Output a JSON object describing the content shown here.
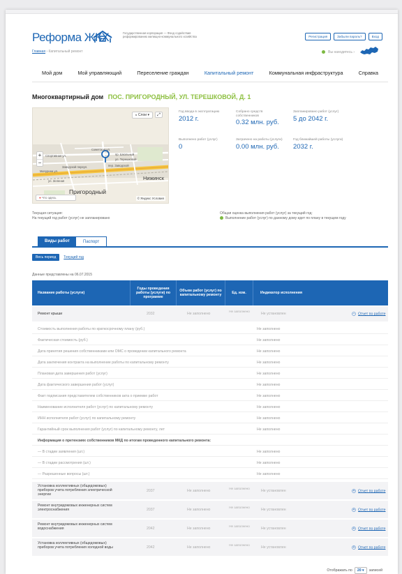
{
  "header": {
    "logo_text": "Реформа ЖКХ",
    "org_text": "Государственная корпорация — Фонд содействия реформированию жилищно-коммунального хозяйства",
    "breadcrumb_home": "Главная",
    "breadcrumb_sep": "›",
    "breadcrumb_current": "Капитальный ремонт",
    "buttons": {
      "register": "Регистрация",
      "forgot": "Забыли пароль?",
      "login": "Вход"
    },
    "location_text": "Вы находитесь",
    "location_sep": "›"
  },
  "nav": {
    "items": [
      "Мой дом",
      "Мой управляющий",
      "Переселение граждан",
      "Капитальный ремонт",
      "Коммунальная инфраструктура",
      "Справка"
    ],
    "active_index": 3
  },
  "house": {
    "title": "Многоквартирный дом",
    "address": "ПОС. ПРИГОРОДНЫЙ, УЛ. ТЕРЕШКОВОЙ, Д. 1"
  },
  "map": {
    "layers": "Слои",
    "zoom_in": "+",
    "zoom_out": "−",
    "search": "Что здесь",
    "brand": "© Яндекс Условия",
    "labels": [
      "Спортивная ул.",
      "Советская ул.",
      "пр. Школьный",
      "ул. Терешковой",
      "Заводской переул.",
      "Мичурина ул.",
      "ул. Зеленая",
      "пер. Заводской"
    ],
    "town": "Пригородный",
    "town2": "Нижинск"
  },
  "stats": {
    "year_built_label": "Год ввода в эксплуатацию",
    "year_built_value": "2012 г.",
    "collected_label": "Собрано средств собственников",
    "collected_value": "0.32 млн. руб.",
    "planned_label": "Запланировано работ (услуг)",
    "planned_value": "5 до 2042 г.",
    "done_label": "Выполнено работ (услуг)",
    "done_value": "0",
    "spent_label": "Затрачено на работы (услуги)",
    "spent_value": "0.00 млн. руб.",
    "nearest_label": "Год ближайшей работы (услуги)",
    "nearest_value": "2032 г."
  },
  "situation": {
    "title": "Текущая ситуация:",
    "text": "На текущий год работ (услуг) не запланировано"
  },
  "assessment": {
    "title": "Общая оценка выполнения работ (услуг) за текущий год:",
    "text": "Выполнение работ (услуг) по данному дому идет по плану в текущем году",
    "color": "#7db942"
  },
  "tabs": {
    "works": "Виды работ",
    "passport": "Паспорт"
  },
  "period": {
    "all": "Весь период",
    "current": "Текущий год"
  },
  "data_date": "Данные представлены на 06.07.2015",
  "table": {
    "headers": [
      "Название работы (услуги)",
      "Годы проведения работы (услуги) по программе",
      "Объем работ (услуг) по капитальному ремонту",
      "Ед. изм.",
      "Индикатор исполнения"
    ],
    "main_row": {
      "name": "Ремонт крыши",
      "year": "2032",
      "volume": "Не заполнено",
      "unit": "Не заполнено",
      "indicator": "Не установлен",
      "report": "Отчет по работе"
    },
    "details": [
      {
        "label": "Стоимость выполнения работы по краткосрочному плану (руб.)",
        "value": "Не заполнено"
      },
      {
        "label": "Фактическая стоимость (руб.)",
        "value": "Не заполнено"
      },
      {
        "label": "Дата принятия решения собственниками или ОМС о проведении капитального ремонта",
        "value": "Не заполнено"
      },
      {
        "label": "Дата заключения контракта на выполнение работы по капитальному ремонту",
        "value": "Не заполнено"
      },
      {
        "label": "Плановая дата завершения работ (услуг)",
        "value": "Не заполнено"
      },
      {
        "label": "Дата фактического завершения работ (услуг)",
        "value": "Не заполнено"
      },
      {
        "label": "Факт подписания представителем собственников акта о приемке работ",
        "value": "Не заполнено"
      },
      {
        "label": "Наименование исполнителя работ (услуг) по капитальному ремонту",
        "value": "Не заполнено"
      },
      {
        "label": "ИНН исполнителя работ (услуг) по капитальному ремонту",
        "value": "Не заполнено"
      },
      {
        "label": "Гарантийный срок выполнения работ (услуг) по капитальному ремонту, лет",
        "value": "Не заполнено"
      },
      {
        "label": "Информация о претензиях собственников МКД по итогам проведенного капитального ремонта:",
        "value": "",
        "bold": true
      },
      {
        "label": "— В стадии заявления (шт.)",
        "value": "Не заполнено"
      },
      {
        "label": "— В стадии рассмотрения (шт.)",
        "value": "Не заполнено"
      },
      {
        "label": "— Разрешенные вопросы (шт.)",
        "value": "Не заполнено"
      }
    ],
    "rows": [
      {
        "name": "Установка коллективных (общедомовых) приборов учета потребления электрической энергии",
        "year": "2037",
        "volume": "Не заполнено",
        "unit": "Не заполнено",
        "indicator": "Не установлен",
        "report": "Отчет по работе"
      },
      {
        "name": "Ремонт внутридомовых инженерных систем электроснабжения",
        "year": "2037",
        "volume": "Не заполнено",
        "unit": "Не заполнено",
        "indicator": "Не установлен",
        "report": "Отчет по работе"
      },
      {
        "name": "Ремонт внутридомовых инженерных систем водоснабжения",
        "year": "2042",
        "volume": "Не заполнено",
        "unit": "Не заполнено",
        "indicator": "Не установлен",
        "report": "Отчет по работе"
      },
      {
        "name": "Установка коллективных (общедомовых) приборов учета потребления холодной воды",
        "year": "2042",
        "volume": "Не заполнено",
        "unit": "Не заполнено",
        "indicator": "Не установлен",
        "report": "Отчет по работе"
      }
    ]
  },
  "footer": {
    "show_label": "Отображать по",
    "page_size": "20 ▾",
    "records": "записей"
  },
  "colors": {
    "accent": "#1d66b4",
    "green": "#8cbf3f"
  }
}
